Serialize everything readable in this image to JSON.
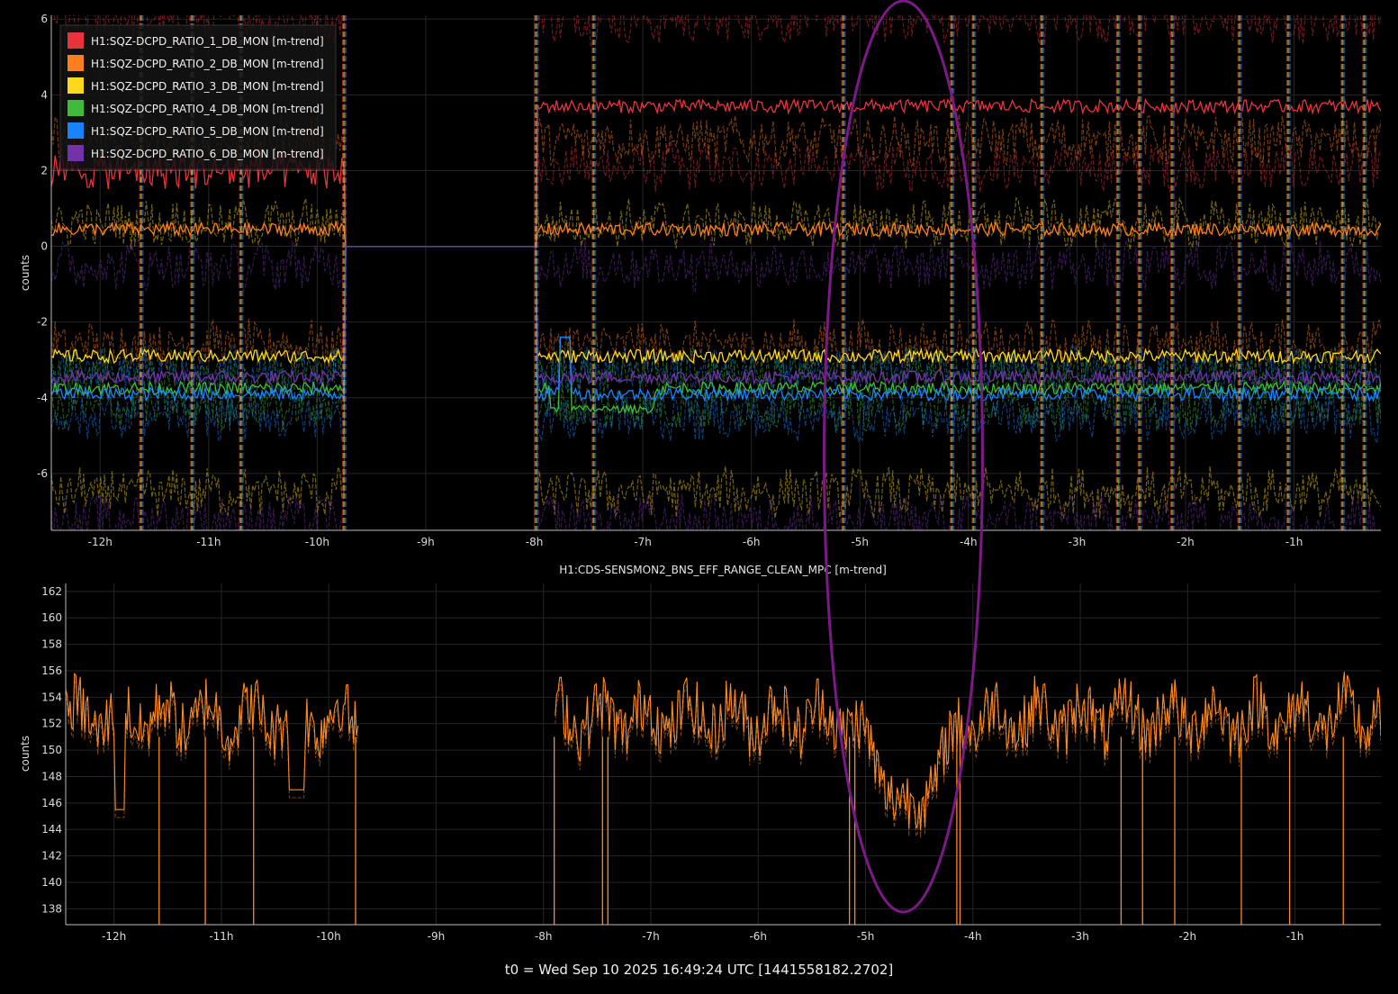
{
  "footer": "t0 = Wed Sep 10 2025 16:49:24 UTC [1441558182.2702]",
  "annotation": {
    "type": "ellipse",
    "color": "#7b1a86",
    "center_x": -4.6,
    "spans": "both panels"
  },
  "chart_data": [
    {
      "type": "line",
      "title": "",
      "ylabel": "counts",
      "xlabel": "",
      "xlim": [
        -12.45,
        -0.2
      ],
      "ylim": [
        -7.5,
        6.1
      ],
      "x_ticks": [
        "-12h",
        "-11h",
        "-10h",
        "-9h",
        "-8h",
        "-7h",
        "-6h",
        "-5h",
        "-4h",
        "-3h",
        "-2h",
        "-1h"
      ],
      "x_tick_values": [
        -12,
        -11,
        -10,
        -9,
        -8,
        -7,
        -6,
        -5,
        -4,
        -3,
        -2,
        -1
      ],
      "y_ticks": [
        "6",
        "4",
        "2",
        "0",
        "-2",
        "-4",
        "-6"
      ],
      "y_tick_values": [
        6,
        4,
        2,
        0,
        -2,
        -4,
        -6
      ],
      "grid": true,
      "legend_position": "top-left",
      "gap": {
        "from": -9.75,
        "to": -7.98,
        "value": 0
      },
      "dropouts": [
        -11.62,
        -11.15,
        -10.7,
        -9.75,
        -7.98,
        -7.45,
        -5.15,
        -4.15,
        -3.95,
        -3.32,
        -2.62,
        -2.42,
        -2.12,
        -1.5,
        -1.05,
        -0.55,
        -0.35
      ],
      "series": [
        {
          "name": "H1:SQZ-DCPD_RATIO_1_DB_MON [m-trend]",
          "color": "#e8333c",
          "mean": 3.7,
          "min_band": [
            2.1,
            6.0
          ],
          "max_band_dashed": true,
          "level_after_gap": 3.7,
          "level_before_gap": null
        },
        {
          "name": "H1:SQZ-DCPD_RATIO_2_DB_MON [m-trend]",
          "color": "#ff7f1e",
          "mean": 0.45,
          "min_band": [
            -2.6,
            2.8
          ]
        },
        {
          "name": "H1:SQZ-DCPD_RATIO_3_DB_MON [m-trend]",
          "color": "#ffd81c",
          "mean": -2.9,
          "min_band": [
            -6.5,
            0.6
          ]
        },
        {
          "name": "H1:SQZ-DCPD_RATIO_4_DB_MON [m-trend]",
          "color": "#3fbc3a",
          "mean": -3.75,
          "min_band": [
            -4.2,
            -3.3
          ]
        },
        {
          "name": "H1:SQZ-DCPD_RATIO_5_DB_MON [m-trend]",
          "color": "#1882ff",
          "mean": -3.9,
          "min_band": [
            -4.5,
            -3.3
          ]
        },
        {
          "name": "H1:SQZ-DCPD_RATIO_6_DB_MON [m-trend]",
          "color": "#7332a8",
          "mean": -3.45,
          "min_band": [
            -7.2,
            -0.5
          ]
        }
      ]
    },
    {
      "type": "line",
      "title": "H1:CDS-SENSMON2_BNS_EFF_RANGE_CLEAN_MPC [m-trend]",
      "ylabel": "counts",
      "xlabel": "",
      "xlim": [
        -12.45,
        -0.2
      ],
      "ylim": [
        136.8,
        162.6
      ],
      "x_ticks": [
        "-12h",
        "-11h",
        "-10h",
        "-9h",
        "-8h",
        "-7h",
        "-6h",
        "-5h",
        "-4h",
        "-3h",
        "-2h",
        "-1h"
      ],
      "x_tick_values": [
        -12,
        -11,
        -10,
        -9,
        -8,
        -7,
        -6,
        -5,
        -4,
        -3,
        -2,
        -1
      ],
      "y_ticks": [
        "162",
        "160",
        "158",
        "156",
        "154",
        "152",
        "150",
        "148",
        "146",
        "144",
        "142",
        "140",
        "138"
      ],
      "y_tick_values": [
        162,
        160,
        158,
        156,
        154,
        152,
        150,
        148,
        146,
        144,
        142,
        140,
        138
      ],
      "grid": true,
      "gap": {
        "from": -9.72,
        "to": -7.9
      },
      "dip": {
        "x": -4.6,
        "y": 145
      },
      "dropouts": [
        -11.58,
        -11.15,
        -10.7,
        -9.75,
        -7.9,
        -7.45,
        -7.4,
        -5.15,
        -5.1,
        -4.15,
        -4.12,
        -2.62,
        -2.42,
        -2.12,
        -1.5,
        -1.05,
        -0.55
      ],
      "series": [
        {
          "name": "H1:CDS-SENSMON2_BNS_EFF_RANGE_CLEAN_MPC [m-trend]",
          "color": "#ff8a1f",
          "mean": 152.5
        }
      ]
    }
  ]
}
